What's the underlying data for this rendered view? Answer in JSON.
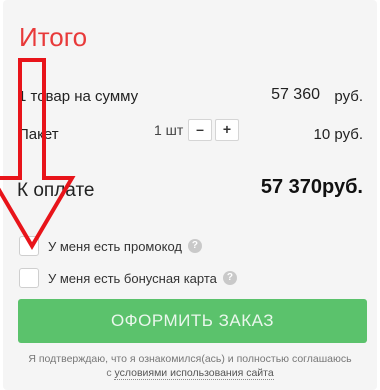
{
  "summary": {
    "title": "Итого",
    "items_label": "1 товар на сумму",
    "items_amount": "57 360",
    "items_currency": "руб.",
    "package_label": "Пакет",
    "package_qty": "1 шт",
    "minus_label": "–",
    "plus_label": "+",
    "package_price": "10 руб.",
    "total_label": "К оплате",
    "total_value": "57 370руб."
  },
  "options": {
    "promo_label": "У меня есть промокод",
    "bonus_label": "У меня есть бонусная карта",
    "help_glyph": "?"
  },
  "actions": {
    "order_label": "ОФОРМИТЬ ЗАКАЗ"
  },
  "agreement": {
    "text": "Я подтверждаю, что я ознакомился(ась) и полностью соглашаюсь",
    "link_prefix": "с",
    "link": "условиями использования сайта"
  },
  "annotation": {
    "arrow_color": "#e8141a"
  }
}
